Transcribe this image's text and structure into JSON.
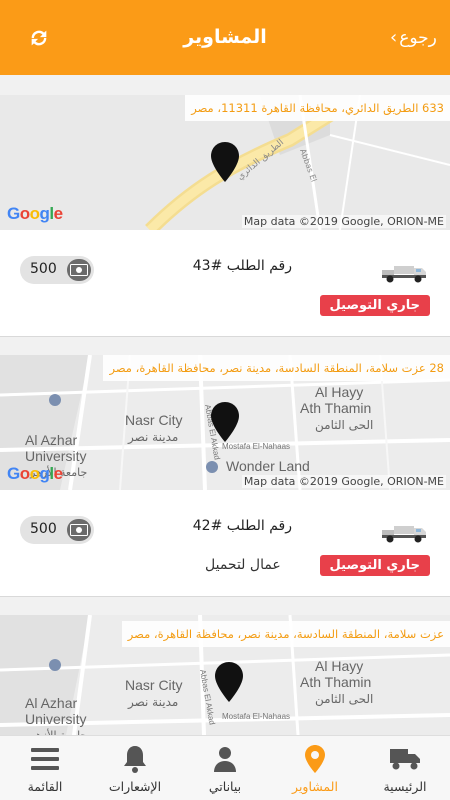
{
  "header": {
    "title": "المشاوير",
    "back_label": "رجوع",
    "refresh_icon": "refresh-icon",
    "accent": "#fb9b17"
  },
  "map": {
    "google_logo": "Google",
    "map_data": "Map data ©2019 Google, ORION-ME",
    "labels": [
      "Nasr City",
      "مدينة نصر",
      "Al Azhar",
      "University",
      "جامعة الأزهر",
      "Al Hayy",
      "Ath Thamin",
      "الحى الثامن",
      "Wonder Land",
      "Mostafa El-Nahaas",
      "Abbas El Akkad",
      "Abbas Al",
      "Ebeid"
    ]
  },
  "trips": [
    {
      "address": "633 الطريق الدائري، محافظة القاهرة 11311، مصر",
      "order_label": "رقم الطلب #43",
      "price": "500",
      "status": "جاري التوصيل",
      "cargo": ""
    },
    {
      "address": "28 عزت سلامة، المنطقة السادسة، مدينة نصر، محافظة القاهرة، مصر",
      "order_label": "رقم الطلب #42",
      "price": "500",
      "status": "جاري التوصيل",
      "cargo": "عمال لتحميل"
    },
    {
      "address": "عزت سلامة، المنطقة السادسة، مدينة نصر، محافظة القاهرة، مصر",
      "order_label": "",
      "price": "",
      "status": "",
      "cargo": ""
    }
  ],
  "bottom_nav": {
    "items": [
      {
        "label": "الرئيسية",
        "icon": "truck-icon"
      },
      {
        "label": "المشاوير",
        "icon": "location-pin-icon"
      },
      {
        "label": "بياناتي",
        "icon": "user-icon"
      },
      {
        "label": "الإشعارات",
        "icon": "bell-icon"
      },
      {
        "label": "القائمة",
        "icon": "menu-icon"
      }
    ],
    "active": "المشاوير"
  }
}
